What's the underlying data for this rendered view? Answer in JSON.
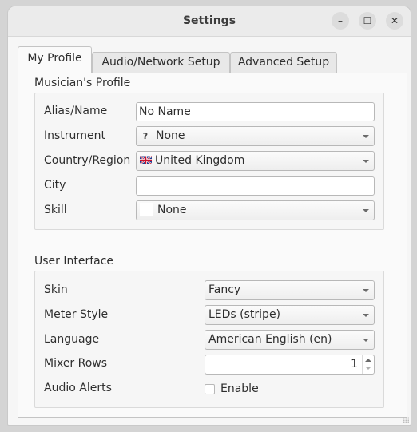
{
  "window": {
    "title": "Settings",
    "minimize_label": "–",
    "maximize_label": "☐",
    "close_label": "✕"
  },
  "tabs": [
    {
      "label": "My Profile",
      "active": true
    },
    {
      "label": "Audio/Network Setup",
      "active": false
    },
    {
      "label": "Advanced Setup",
      "active": false
    }
  ],
  "profile": {
    "title": "Musician's Profile",
    "alias_label": "Alias/Name",
    "alias_value": "No Name",
    "instrument_label": "Instrument",
    "instrument_icon": "?",
    "instrument_value": "None",
    "country_label": "Country/Region",
    "country_value": "United Kingdom",
    "city_label": "City",
    "city_value": "",
    "skill_label": "Skill",
    "skill_value": "None"
  },
  "ui": {
    "title": "User Interface",
    "skin_label": "Skin",
    "skin_value": "Fancy",
    "meter_label": "Meter Style",
    "meter_value": "LEDs (stripe)",
    "language_label": "Language",
    "language_value": "American English (en)",
    "mixer_rows_label": "Mixer Rows",
    "mixer_rows_value": "1",
    "audio_alerts_label": "Audio Alerts",
    "audio_alerts_checkbox_label": "Enable",
    "audio_alerts_checked": false
  }
}
